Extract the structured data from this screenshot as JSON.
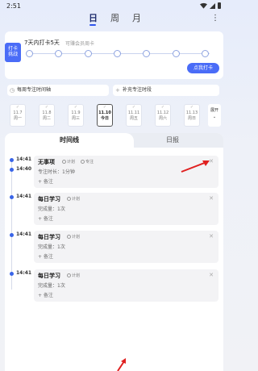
{
  "status_bar": {
    "time": "2:51"
  },
  "tabs": {
    "day": "日",
    "week": "周",
    "month": "月",
    "more": "⋮"
  },
  "checkin": {
    "badge_line1": "打卡",
    "badge_line2": "挑战",
    "title": "7天内打卡5天",
    "subtitle": "可赚会员周卡",
    "button": "点我打卡",
    "days": 7
  },
  "focus": {
    "timeline_label": "每周专注时间轴",
    "add_label": "补充专注时段"
  },
  "dates": [
    {
      "date": "11.7",
      "weekday": "周一",
      "today": false
    },
    {
      "date": "11.8",
      "weekday": "周二",
      "today": false
    },
    {
      "date": "11.9",
      "weekday": "周三",
      "today": false
    },
    {
      "date": "11.10",
      "weekday": "今日",
      "today": true
    },
    {
      "date": "11.11",
      "weekday": "周五",
      "today": false
    },
    {
      "date": "11.12",
      "weekday": "周六",
      "today": false
    },
    {
      "date": "11.13",
      "weekday": "周日",
      "today": false
    }
  ],
  "date_more": {
    "line1": "展开",
    "line2": "⌄"
  },
  "subtabs": {
    "timeline": "时间线",
    "daily": "日报"
  },
  "entries": [
    {
      "time_start": "14:41",
      "time_end": "14:40",
      "title": "无事项",
      "tag1": "计划",
      "tag2": "专注",
      "line2": "专注时长：1分钟",
      "note": "+ 备注"
    },
    {
      "time_start": "14:41",
      "title": "每日学习",
      "tag1": "计划",
      "line2": "完成量：1次",
      "note": "+ 备注"
    },
    {
      "time_start": "14:41",
      "title": "每日学习",
      "tag1": "计划",
      "line2": "完成量：1次",
      "note": "+ 备注"
    },
    {
      "time_start": "14:41",
      "title": "每日学习",
      "tag1": "计划",
      "line2": "完成量：1次",
      "note": "+ 备注"
    }
  ],
  "colors": {
    "accent": "#4a6cf7",
    "arrow": "#e02020"
  }
}
